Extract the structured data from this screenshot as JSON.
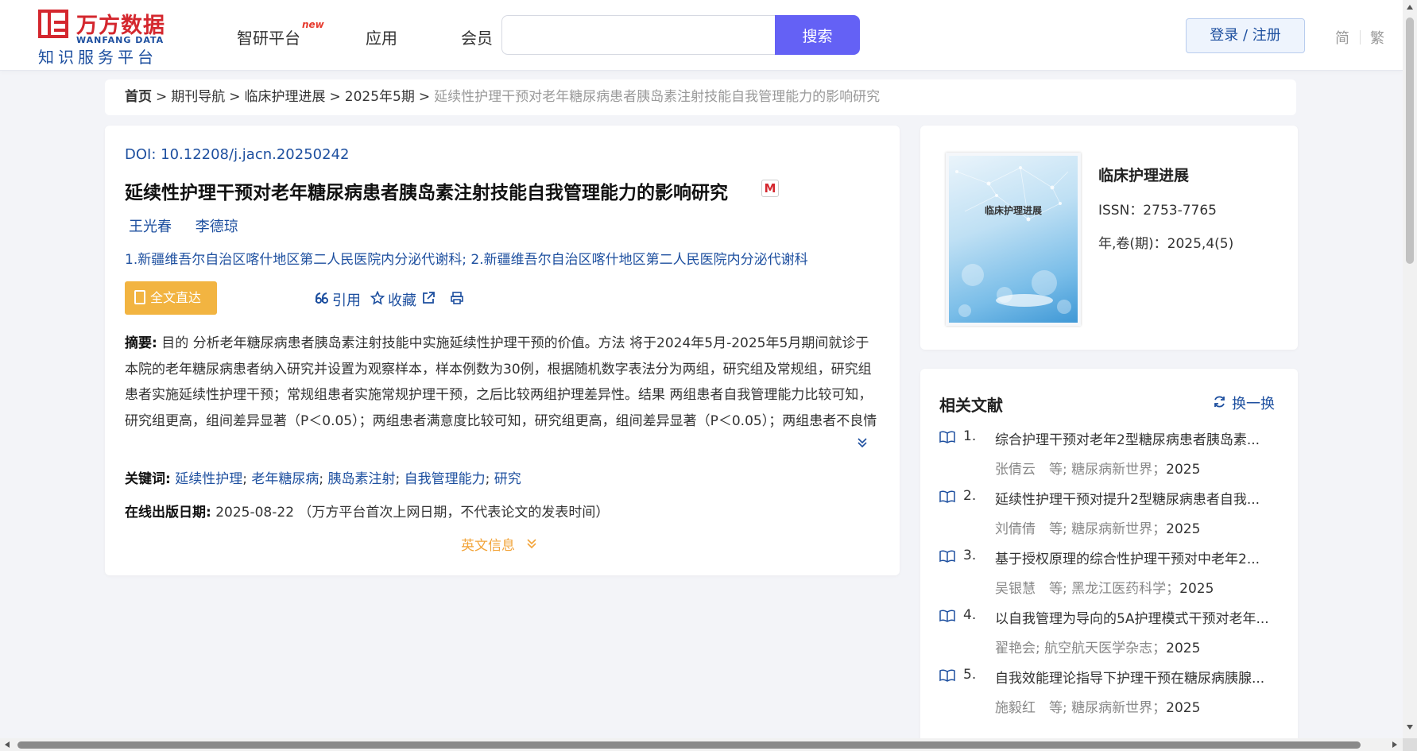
{
  "header": {
    "logo_cn": "万方数据",
    "logo_en": "WANFANG DATA",
    "logo_sub": "知识服务平台",
    "nav": [
      {
        "label": "智研平台",
        "badge": "new"
      },
      {
        "label": "应用"
      },
      {
        "label": "会员"
      }
    ],
    "search_placeholder": "",
    "search_button": "搜索",
    "login": "登录 / 注册",
    "lang_simplified": "简",
    "lang_traditional": "繁"
  },
  "breadcrumb": {
    "home": "首页",
    "items": [
      "期刊导航",
      "临床护理进展",
      "2025年5期"
    ],
    "current": "延续性护理干预对老年糖尿病患者胰岛素注射技能自我管理能力的影响研究",
    "separator": ">"
  },
  "article": {
    "doi_label": "DOI: ",
    "doi": "10.12208/j.jacn.20250242",
    "title": "延续性护理干预对老年糖尿病患者胰岛素注射技能自我管理能力的影响研究",
    "badge": "M",
    "authors": [
      "王光春",
      "李德琼"
    ],
    "affiliations": "1.新疆维吾尔自治区喀什地区第二人民医院内分泌代谢科; 2.新疆维吾尔自治区喀什地区第二人民医院内分泌代谢科",
    "fulltext_button": "全文直达",
    "tools": {
      "cite": "引用",
      "collect": "收藏"
    },
    "abstract_label": "摘要:",
    "abstract": "目的 分析老年糖尿病患者胰岛素注射技能中实施延续性护理干预的价值。方法 将于2024年5月-2025年5月期间就诊于本院的老年糖尿病患者纳入研究并设置为观察样本，样本例数为30例，根据随机数字表法分为两组，研究组及常规组，研究组患者实施延续性护理干预；常规组患者实施常规护理干预，之后比较两组护理差异性。结果 两组患者自我管理能力比较可知，研究组更高，组间差异显著（P＜0.05）；两组患者满意度比较可知，研究组更高，组间差异显著（P＜0.05）；两组患者不良情绪比较，研究组更低，组间差异显著（P＜0.05）。结论 对老年糖尿病患者胰岛素注射技能中实施延续性...",
    "keywords_label": "关键词:",
    "keywords": [
      "延续性护理",
      "老年糖尿病",
      "胰岛素注射",
      "自我管理能力",
      "研究"
    ],
    "pubdate_label": "在线出版日期:",
    "pubdate": "2025-08-22",
    "pubdate_note": "（万方平台首次上网日期，不代表论文的发表时间）",
    "english_info": "英文信息"
  },
  "journal": {
    "cover_title": "临床护理进展",
    "name": "临床护理进展",
    "issn": "ISSN：2753-7765",
    "volume": "年,卷(期)：2025,4(5)"
  },
  "related": {
    "title": "相关文献",
    "refresh": "换一换",
    "items": [
      {
        "num": "1.",
        "title": "综合护理干预对老年2型糖尿病患者胰岛素...",
        "meta": "张倩云　等;  糖尿病新世界；",
        "year": "2025"
      },
      {
        "num": "2.",
        "title": "延续性护理干预对提升2型糖尿病患者自我...",
        "meta": "刘倩倩　等;  糖尿病新世界；",
        "year": "2025"
      },
      {
        "num": "3.",
        "title": "基于授权原理的综合性护理干预对中老年2...",
        "meta": "吴银慧　等;  黑龙江医药科学；",
        "year": "2025"
      },
      {
        "num": "4.",
        "title": "以自我管理为导向的5A护理模式干预对老年...",
        "meta": "翟艳会; 航空航天医学杂志；",
        "year": "2025"
      },
      {
        "num": "5.",
        "title": "自我效能理论指导下护理干预在糖尿病胰腺...",
        "meta": "施毅红　等;  糖尿病新世界；",
        "year": "2025"
      }
    ]
  },
  "colors": {
    "accent": "#6461f5",
    "link": "#1d4f9f",
    "brand_red": "#d4272e",
    "fulltext": "#f2b441",
    "english_info": "#f2a43a"
  }
}
